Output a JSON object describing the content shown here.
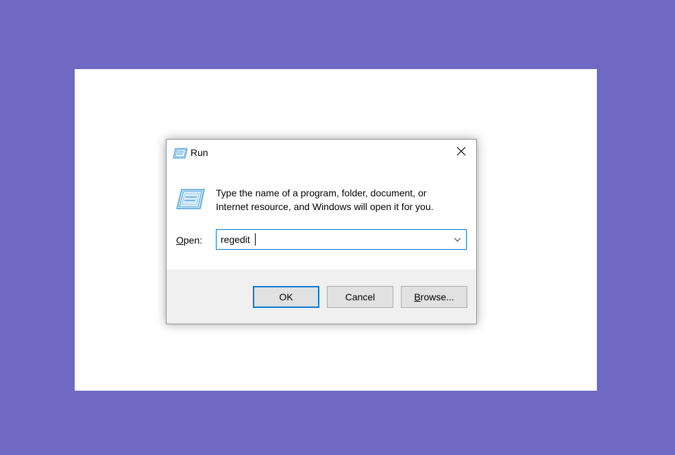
{
  "dialog": {
    "title": "Run",
    "title_icon": "run-icon",
    "close_icon": "close-icon",
    "description_line1": "Type the name of a program, folder, document, or",
    "description_line2": "Internet resource, and Windows will open it for you.",
    "open_label_accel": "O",
    "open_label_rest": "pen:",
    "open_value": "regedit",
    "dropdown_icon": "chevron-down-icon",
    "buttons": {
      "ok": "OK",
      "cancel": "Cancel",
      "browse_accel": "B",
      "browse_rest": "rowse..."
    }
  },
  "colors": {
    "outer_background": "#6f69c3",
    "canvas": "#ffffff",
    "accent": "#0078d7",
    "footer": "#f0f0f0",
    "button_face": "#e1e1e1"
  }
}
